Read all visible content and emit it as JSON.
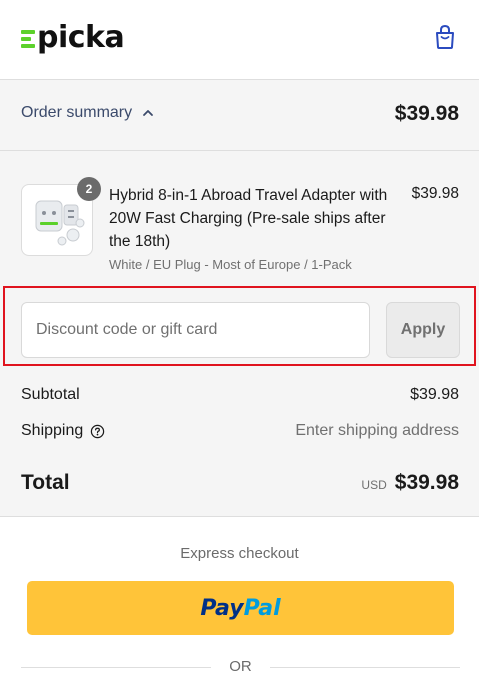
{
  "header": {
    "logo_text": "picka",
    "logo_color": "#5cd12b",
    "cart_icon": "shopping-bag-icon"
  },
  "summary": {
    "toggle_label": "Order summary",
    "total": "$39.98"
  },
  "item": {
    "quantity": "2",
    "title": "Hybrid 8-in-1 Abroad Travel Adapter with 20W Fast Charging (Pre-sale ships after the 18th)",
    "variant": "White / EU Plug - Most of Europe / 1-Pack",
    "price": "$39.98"
  },
  "discount": {
    "placeholder": "Discount code or gift card",
    "apply_label": "Apply"
  },
  "totals": {
    "subtotal_label": "Subtotal",
    "subtotal_value": "$39.98",
    "shipping_label": "Shipping",
    "shipping_value": "Enter shipping address",
    "total_label": "Total",
    "currency": "USD",
    "total_value": "$39.98"
  },
  "express": {
    "label": "Express checkout",
    "paypal_part1": "Pay",
    "paypal_part2": "Pal",
    "or_label": "OR"
  },
  "colors": {
    "accent_red": "#e0141e",
    "paypal_yellow": "#ffc439",
    "paypal_dark": "#003087",
    "paypal_light": "#009cde"
  }
}
